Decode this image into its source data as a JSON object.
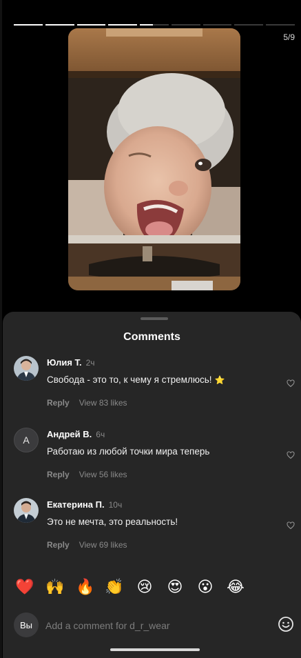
{
  "story": {
    "counter": "5/9",
    "segments": [
      1,
      1,
      1,
      1,
      0.45,
      0,
      0,
      0,
      0
    ]
  },
  "sheet": {
    "title": "Comments"
  },
  "comments": [
    {
      "author": "Юлия Т.",
      "time": "2ч",
      "text": "Свобода - это то, к чему я стремлюсь!",
      "emoji": "⭐",
      "reply": "Reply",
      "likes": "View 83 likes",
      "avatar": "photo-woman"
    },
    {
      "author": "Андрей В.",
      "time": "6ч",
      "text": "Работаю из любой точки мира теперь",
      "reply": "Reply",
      "likes": "View 56 likes",
      "avatar_letter": "А"
    },
    {
      "author": "Екатерина П.",
      "time": "10ч",
      "text": "Это не мечта, это реальность!",
      "reply": "Reply",
      "likes": "View 69 likes",
      "avatar": "photo-man"
    }
  ],
  "quick_reactions": [
    "❤️",
    "🙌",
    "🔥",
    "👏",
    "😢",
    "😍",
    "😮",
    "😂"
  ],
  "composer": {
    "avatar_label": "Вы",
    "placeholder": "Add a comment for d_r_wear"
  },
  "colors": {
    "sheet": "#262626",
    "muted": "#8a8a8a",
    "background": "#000000"
  }
}
